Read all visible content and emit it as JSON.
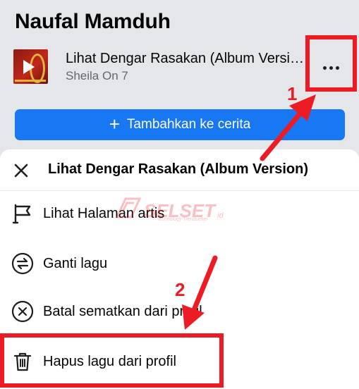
{
  "profile": {
    "name": "Naufal Mamduh"
  },
  "song": {
    "title": "Lihat Dengar Rasakan (Album Version)",
    "artist": "Sheila On 7"
  },
  "more_button": {
    "icon": "more-horizontal-icon"
  },
  "add_story_button": {
    "icon": "plus",
    "label": "Tambahkan ke cerita"
  },
  "sheet": {
    "close_icon": "close-icon",
    "title": "Lihat Dengar Rasakan (Album Version)",
    "items": [
      {
        "icon": "flag-icon",
        "label": "Lihat Halaman artis"
      },
      {
        "icon": "swap-icon",
        "label": "Ganti lagu"
      },
      {
        "icon": "circle-x-icon",
        "label": "Batal sematkan dari profil"
      },
      {
        "icon": "trash-icon",
        "label": "Hapus lagu dari profil"
      }
    ]
  },
  "annotations": {
    "step1": "1",
    "step2": "2",
    "color": "#ed1c24"
  },
  "watermark": {
    "brand": "SELSET",
    "tld": "id",
    "tagline": "Technology Trendsetter"
  },
  "colors": {
    "accent": "#1877f2",
    "annotation": "#ed1c24"
  }
}
